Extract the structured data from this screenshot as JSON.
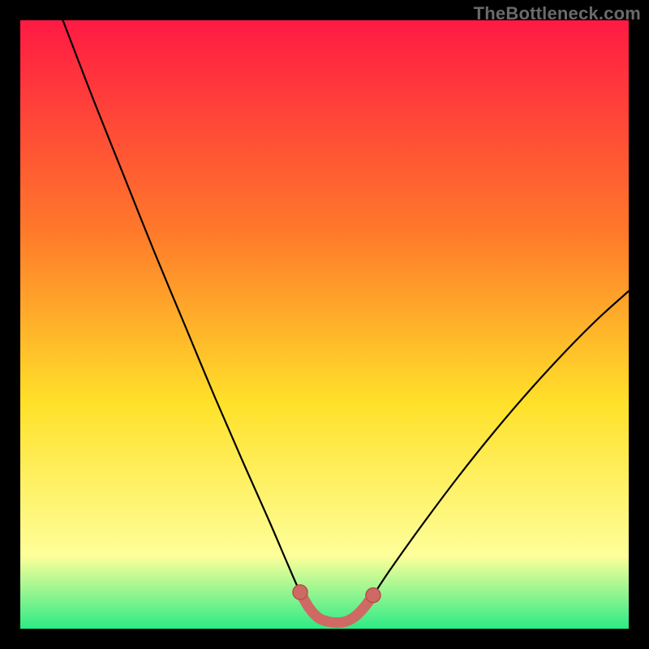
{
  "watermark": "TheBottleneck.com",
  "colors": {
    "page_bg": "#000000",
    "curve": "#000000",
    "marker_fill": "#CE6A63",
    "marker_stroke": "#B64F49",
    "gradient_top": "#FF1A44",
    "gradient_mid_upper": "#FF7A2A",
    "gradient_mid": "#FFE12A",
    "gradient_lower": "#FEFF9A",
    "gradient_bottom": "#2CEB86"
  },
  "chart_data": {
    "type": "line",
    "title": "",
    "xlabel": "",
    "ylabel": "",
    "xlim": [
      0.0,
      1.0
    ],
    "ylim": [
      0.0,
      1.0
    ],
    "x_of_minimum": 0.52,
    "optimal_range_x": [
      0.46,
      0.58
    ],
    "curve_description": "V-shaped bottleneck curve; y decreases steeply from ~1.0 at x≈0.07 to ~0 near x≈0.52, then rises with gentler slope to ~0.55 at x=1.0",
    "series": [
      {
        "name": "bottleneck-curve",
        "points": [
          {
            "x": 0.07,
            "y": 1.0
          },
          {
            "x": 0.12,
            "y": 0.87
          },
          {
            "x": 0.17,
            "y": 0.745
          },
          {
            "x": 0.22,
            "y": 0.62
          },
          {
            "x": 0.27,
            "y": 0.5
          },
          {
            "x": 0.32,
            "y": 0.38
          },
          {
            "x": 0.37,
            "y": 0.265
          },
          {
            "x": 0.41,
            "y": 0.175
          },
          {
            "x": 0.44,
            "y": 0.105
          },
          {
            "x": 0.46,
            "y": 0.06
          },
          {
            "x": 0.48,
            "y": 0.025
          },
          {
            "x": 0.5,
            "y": 0.01
          },
          {
            "x": 0.52,
            "y": 0.007
          },
          {
            "x": 0.54,
            "y": 0.01
          },
          {
            "x": 0.56,
            "y": 0.025
          },
          {
            "x": 0.58,
            "y": 0.055
          },
          {
            "x": 0.61,
            "y": 0.1
          },
          {
            "x": 0.66,
            "y": 0.17
          },
          {
            "x": 0.72,
            "y": 0.25
          },
          {
            "x": 0.78,
            "y": 0.325
          },
          {
            "x": 0.84,
            "y": 0.395
          },
          {
            "x": 0.9,
            "y": 0.46
          },
          {
            "x": 0.95,
            "y": 0.51
          },
          {
            "x": 1.0,
            "y": 0.555
          }
        ]
      },
      {
        "name": "optimal-marker",
        "points": [
          {
            "x": 0.46,
            "y": 0.06
          },
          {
            "x": 0.475,
            "y": 0.034
          },
          {
            "x": 0.49,
            "y": 0.018
          },
          {
            "x": 0.505,
            "y": 0.012
          },
          {
            "x": 0.52,
            "y": 0.01
          },
          {
            "x": 0.535,
            "y": 0.012
          },
          {
            "x": 0.55,
            "y": 0.02
          },
          {
            "x": 0.565,
            "y": 0.035
          },
          {
            "x": 0.58,
            "y": 0.055
          }
        ]
      }
    ]
  }
}
